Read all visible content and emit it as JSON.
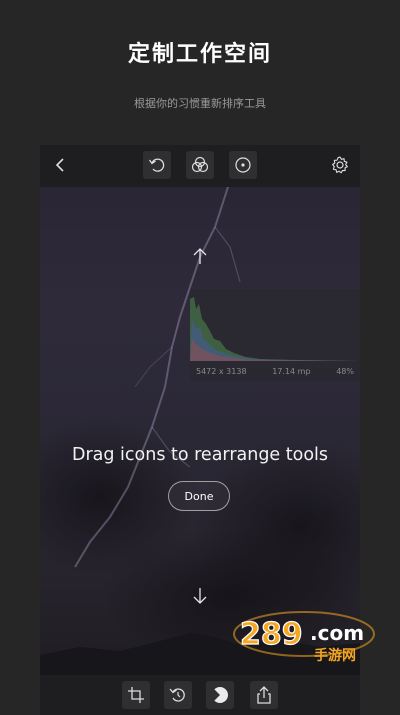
{
  "promo": {
    "title": "定制工作空间",
    "subtitle": "根据你的习惯重新排序工具"
  },
  "topbar": {
    "icons": [
      "back-chevron-icon",
      "undo-icon",
      "filter-icon",
      "tool-circle-icon",
      "gear-icon"
    ]
  },
  "overlay": {
    "message": "Drag icons to rearrange tools",
    "done_label": "Done",
    "up_icon": "arrow-up-icon",
    "down_icon": "arrow-down-icon"
  },
  "histogram": {
    "resolution": "5472 x 3138",
    "size": "17.14 mp",
    "extra": "48%"
  },
  "bottombar": {
    "icons": [
      "crop-icon",
      "rotate-reset-icon",
      "tone-dial-icon",
      "share-icon"
    ]
  },
  "watermark": {
    "brand": "289.com",
    "tagline": "手游网"
  },
  "colors": {
    "background": "#262626",
    "toolbar": "#1e1e20",
    "button": "#2f2f31",
    "watermark_orange": "#f5a623"
  }
}
